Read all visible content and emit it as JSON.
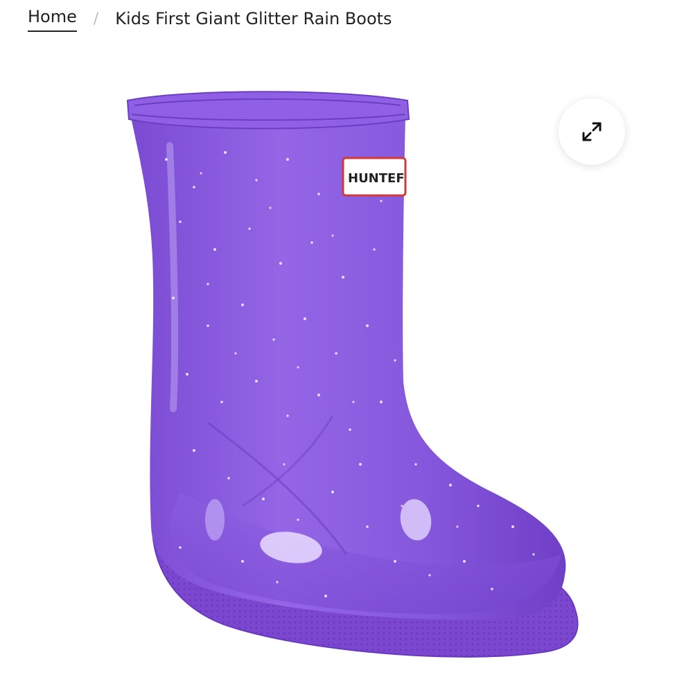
{
  "breadcrumb": {
    "home_label": "Home",
    "separator": "/",
    "current_label": "Kids First Giant Glitter Rain Boots"
  },
  "product": {
    "brand_tag": "HUNTEF",
    "boot_color": "#8a5ad8",
    "sole_color": "#7b47cf"
  },
  "controls": {
    "expand_icon": "expand-arrows-icon"
  }
}
